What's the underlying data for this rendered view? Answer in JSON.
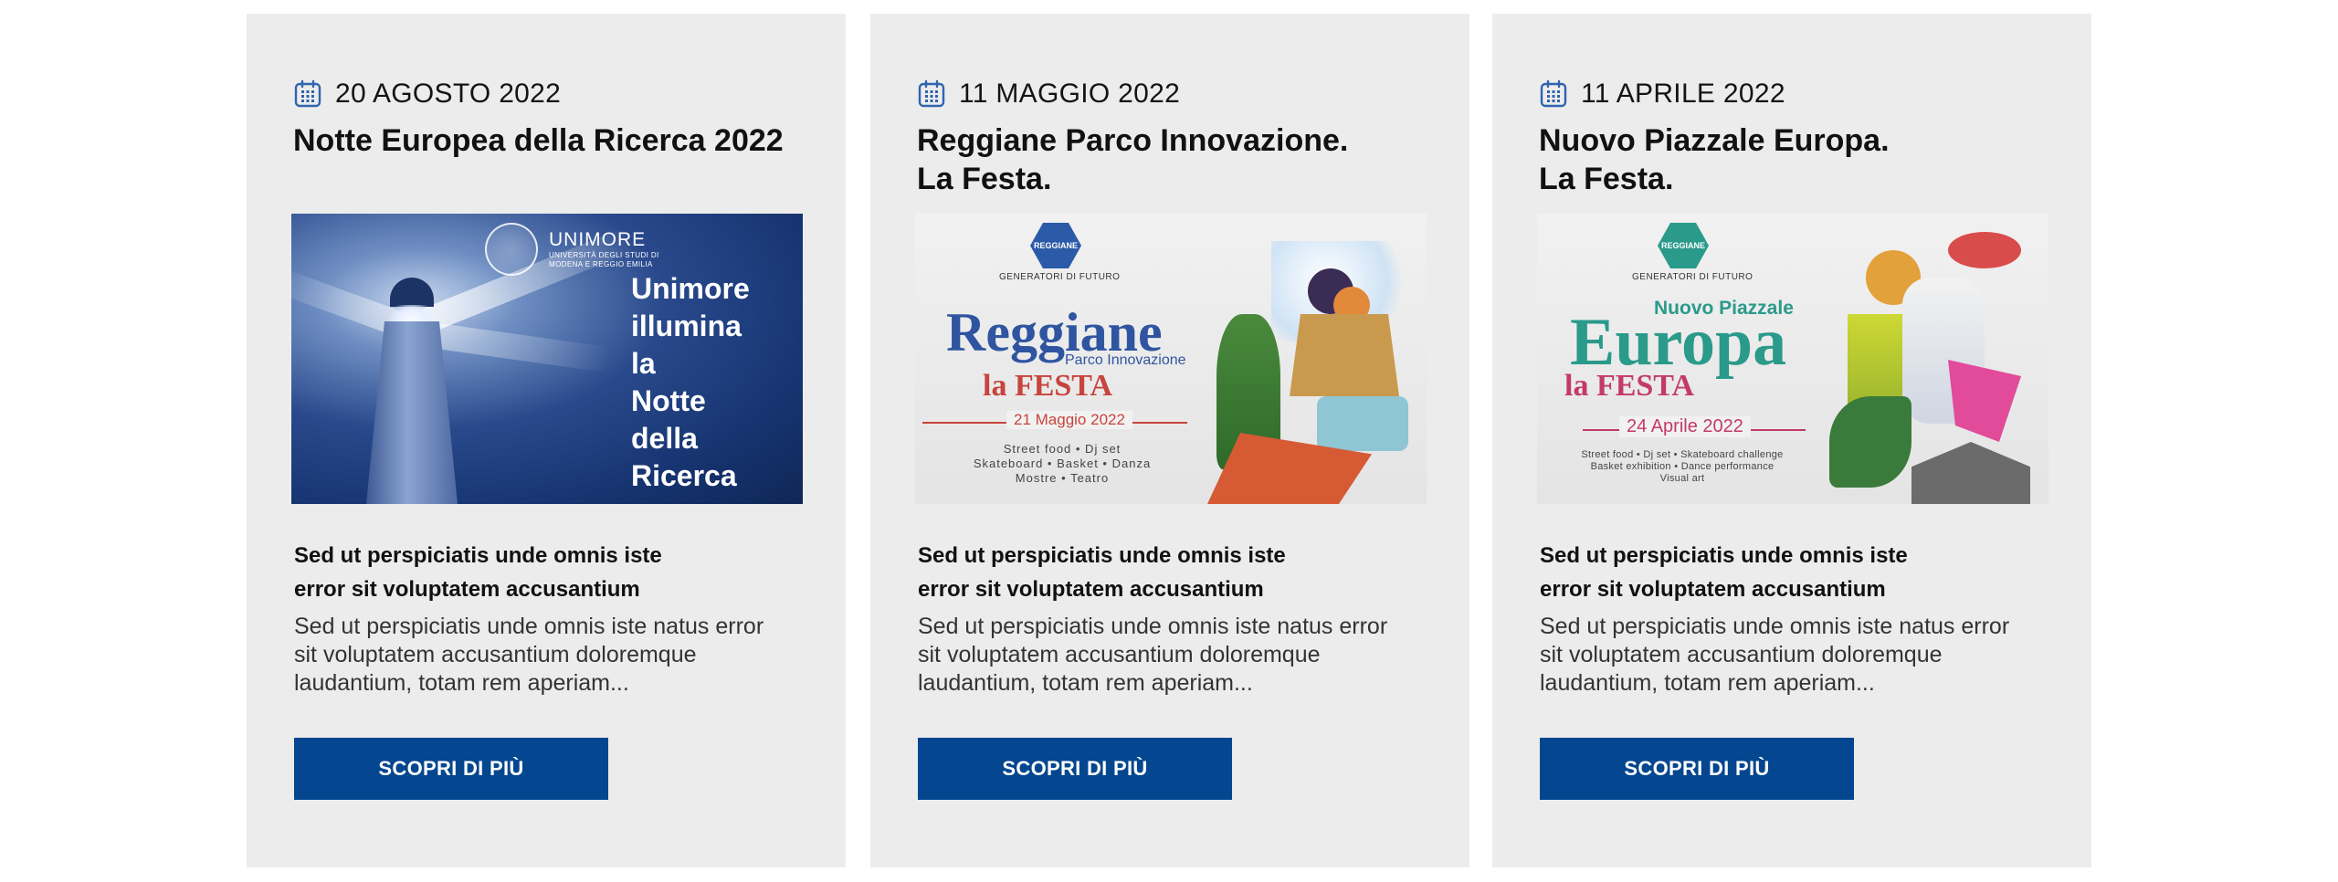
{
  "colors": {
    "card_background": "#ececec",
    "button_background": "#04468f",
    "button_text": "#ffffff",
    "calendar_icon": "#2f64b0"
  },
  "cards": [
    {
      "date": "20 AGOSTO 2022",
      "title": "Notte Europea della Ricerca 2022",
      "banner": {
        "brand": "UNIMORE",
        "brand_sub": "UNIVERSITÀ DEGLI STUDI DI\nMODENA E REGGIO EMILIA",
        "headline": "Unimore\nillumina\nla\nNotte\ndella\nRicerca"
      },
      "subtitle": "Sed ut perspiciatis unde omnis iste\nerror sit voluptatem accusantium",
      "excerpt": "Sed ut perspiciatis unde omnis iste natus error sit voluptatem accusantium doloremque laudantium, totam rem aperiam...",
      "button_label": "SCOPRI DI PIÙ",
      "icon": "calendar-icon"
    },
    {
      "date": "11 MAGGIO 2022",
      "title": "Reggiane Parco Innovazione.\nLa Festa.",
      "banner": {
        "badge": "REGGIANE",
        "tagline": "GENERATORI DI FUTURO",
        "big": "Reggiane",
        "sub": "Parco Innovazione",
        "festa": "la FESTA",
        "event_date": "21 Maggio 2022",
        "program": "Street food • Dj set\nSkateboard • Basket • Danza\nMostre • Teatro"
      },
      "subtitle": "Sed ut perspiciatis unde omnis iste\nerror sit voluptatem accusantium",
      "excerpt": "Sed ut perspiciatis unde omnis iste natus error sit voluptatem accusantium doloremque laudantium, totam rem aperiam...",
      "button_label": "SCOPRI DI PIÙ",
      "icon": "calendar-icon"
    },
    {
      "date": "11 APRILE 2022",
      "title": "Nuovo Piazzale Europa.\nLa Festa.",
      "banner": {
        "badge": "REGGIANE",
        "tagline": "GENERATORI DI FUTURO",
        "sub": "Nuovo Piazzale",
        "big": "Europa",
        "festa": "la FESTA",
        "event_date": "24 Aprile 2022",
        "program": "Street food • Dj set • Skateboard challenge\nBasket exhibition • Dance performance\nVisual art"
      },
      "subtitle": "Sed ut perspiciatis unde omnis iste\nerror sit voluptatem accusantium",
      "excerpt": "Sed ut perspiciatis unde omnis iste natus error sit voluptatem accusantium doloremque laudantium, totam rem aperiam...",
      "button_label": "SCOPRI DI PIÙ",
      "icon": "calendar-icon"
    }
  ]
}
